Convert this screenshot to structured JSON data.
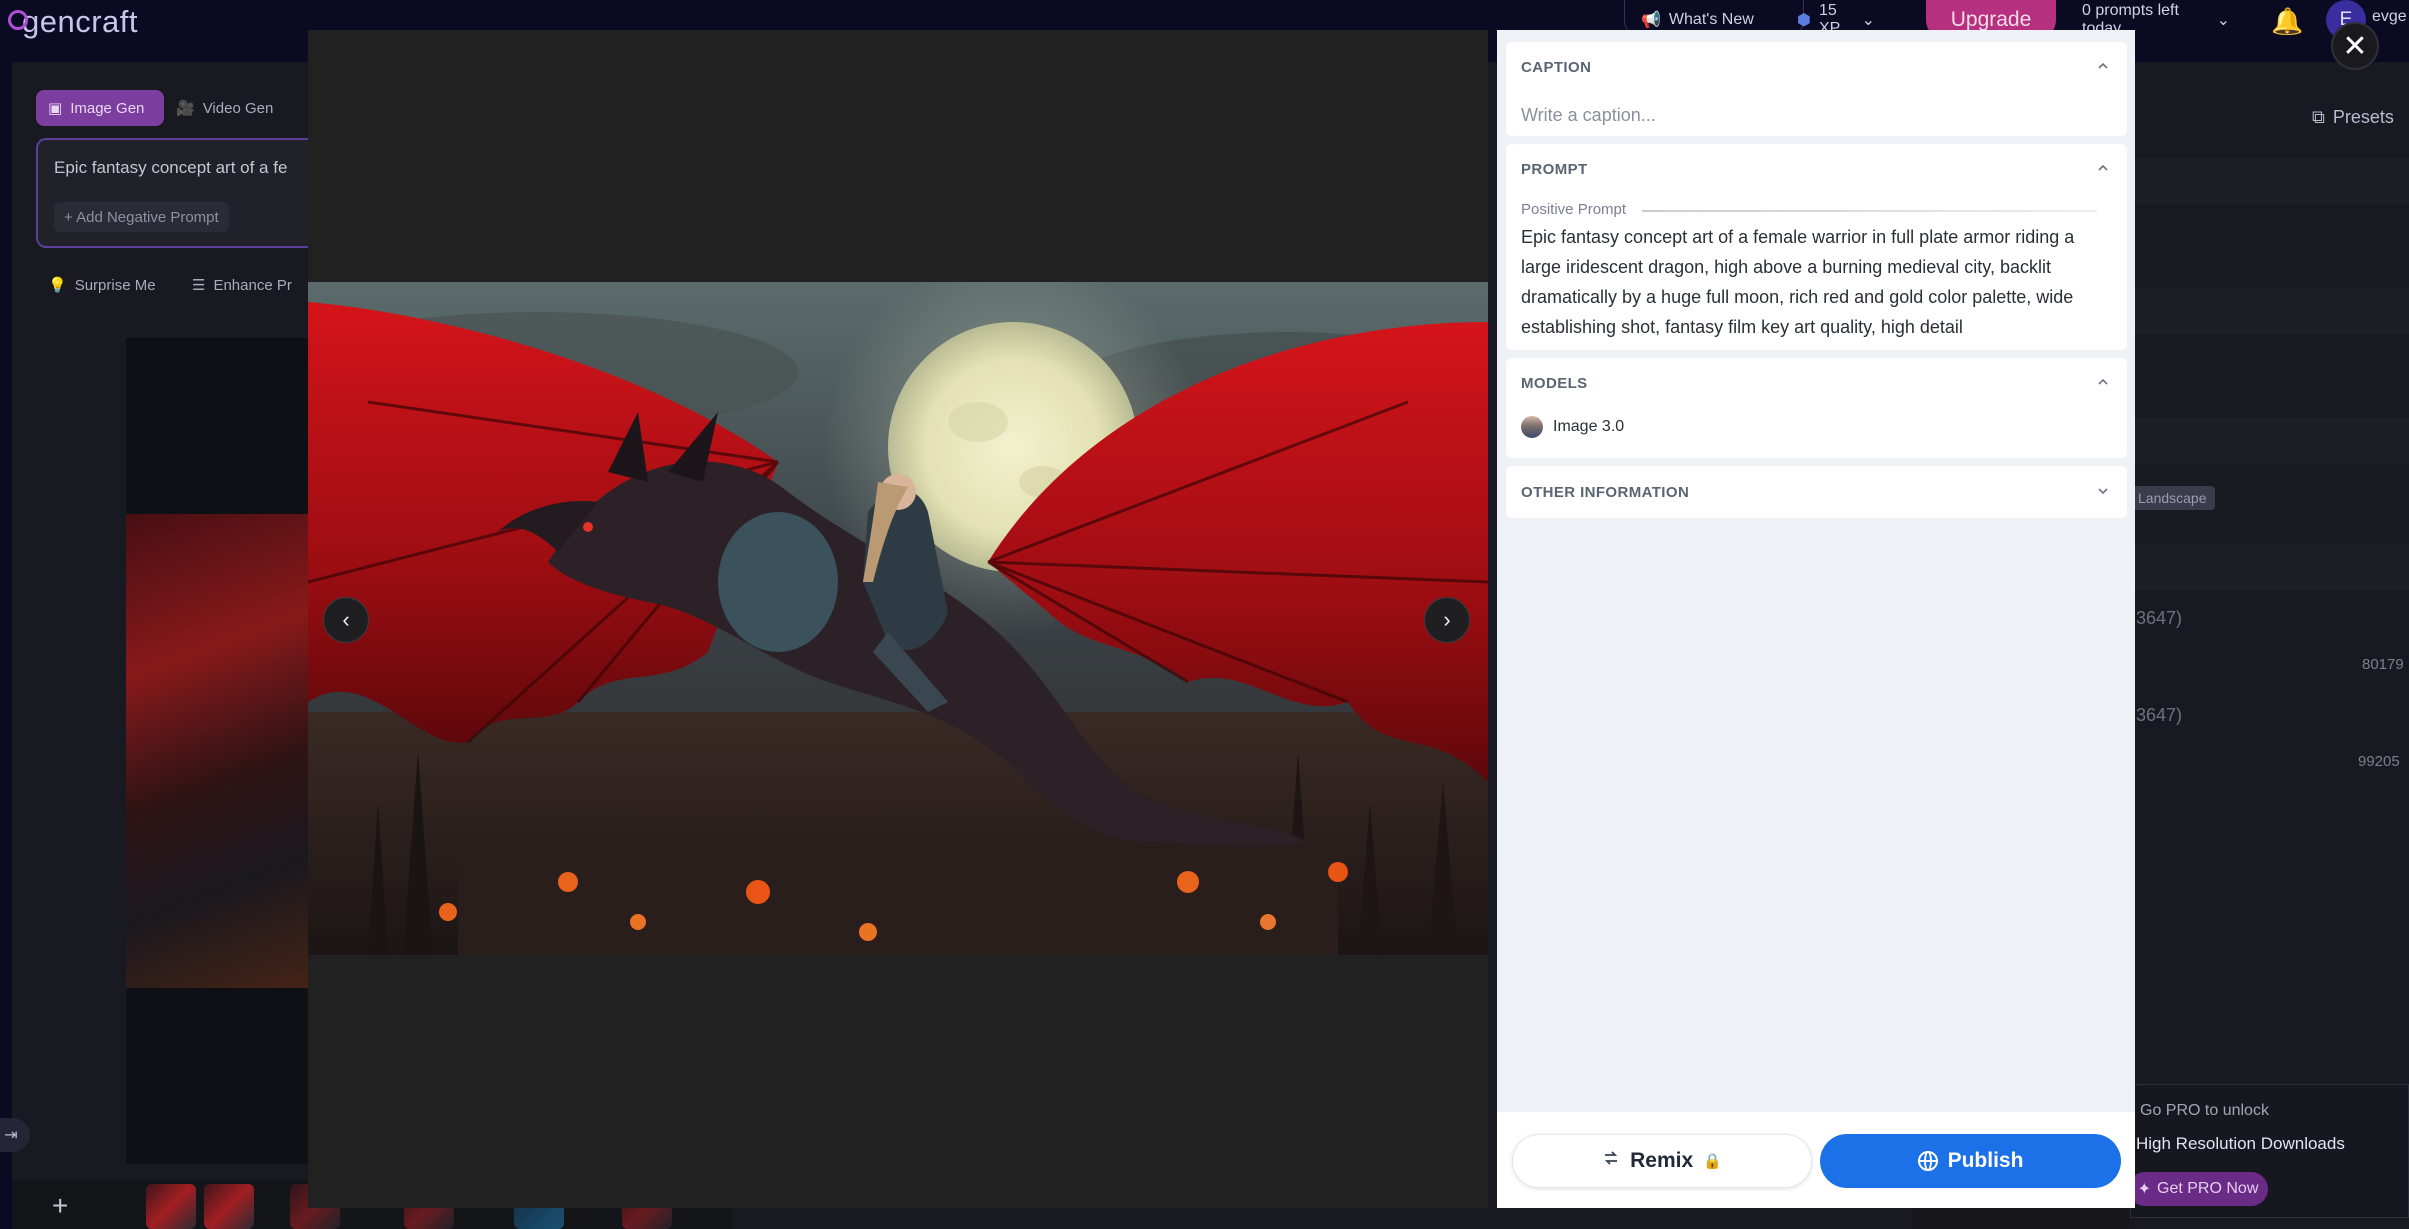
{
  "app": {
    "logo_text": "gencraft",
    "whats_new": "What's New",
    "xp": "15 XP",
    "upgrade": "Upgrade",
    "prompts_left": "0 prompts left today",
    "avatar_initial": "E",
    "username": "evge"
  },
  "workspace": {
    "tabs": [
      {
        "label": "Image Gen"
      },
      {
        "label": "Video Gen"
      }
    ],
    "prompt_preview": "Epic fantasy concept art of a fe",
    "add_negative": "+ Add Negative Prompt",
    "tools": [
      {
        "label": "Surprise Me"
      },
      {
        "label": "Enhance Pr"
      }
    ]
  },
  "right_panel": {
    "presets": "Presets",
    "landscape": "Landscape",
    "item_a": "3647)",
    "item_a_num": "80179",
    "item_b": "3647)",
    "item_b_num": "99205",
    "pro_sub": "Go PRO to unlock",
    "pro_main": "High Resolution Downloads",
    "pro_btn": "Get PRO Now"
  },
  "modal": {
    "caption": {
      "title": "CAPTION",
      "placeholder": "Write a caption..."
    },
    "prompt": {
      "title": "PROMPT",
      "sub_label": "Positive Prompt",
      "text": "Epic fantasy concept art of a female warrior in full plate armor riding a large iridescent dragon, high above a burning medieval city, backlit dramatically by a huge full moon, rich red and gold color palette, wide establishing shot, fantasy film key art quality, high detail"
    },
    "models": {
      "title": "MODELS",
      "items": [
        {
          "name": "Image 3.0"
        }
      ]
    },
    "other": {
      "title": "OTHER INFORMATION"
    },
    "actions": {
      "remix": "Remix",
      "publish": "Publish"
    }
  },
  "icons": {
    "close": "close-icon",
    "prev": "chevron-left-icon",
    "next": "chevron-right-icon",
    "lock": "lock-icon",
    "globe": "globe-icon",
    "remix": "remix-icon"
  },
  "colors": {
    "publish": "#1d71e8",
    "upgrade": "#b5307f",
    "image_tab": "#7b3d9e",
    "topbar": "#0b0a23"
  }
}
